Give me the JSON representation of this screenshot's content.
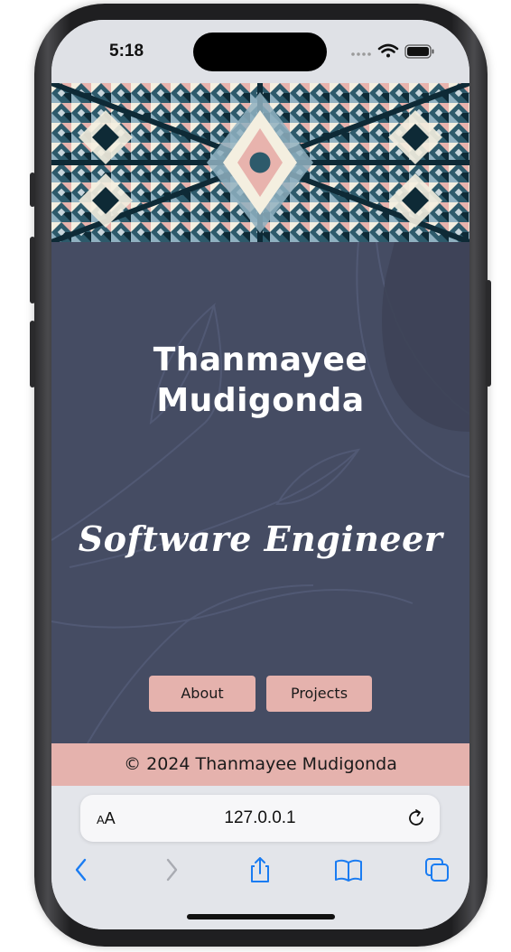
{
  "status_bar": {
    "time": "5:18",
    "icons": [
      "signal-dots-icon",
      "wifi-icon",
      "battery-icon"
    ]
  },
  "hero": {
    "image": "geometric-mosaic-banner",
    "colors": [
      "#2d5a6b",
      "#e8b3ad",
      "#f4efe0",
      "#0e2a36",
      "#8fb0c0"
    ]
  },
  "main": {
    "name": "Thanmayee Mudigonda",
    "subtitle": "Software Engineer",
    "background": "#454c63",
    "buttons": {
      "about_label": "About",
      "projects_label": "Projects"
    }
  },
  "footer": {
    "text": "© 2024 Thanmayee Mudigonda",
    "background": "#e5b2ad"
  },
  "browser": {
    "text_size_label": "AA",
    "url": "127.0.0.1",
    "toolbar": [
      "back-icon",
      "forward-icon",
      "share-icon",
      "bookmarks-icon",
      "tabs-icon"
    ],
    "accent": "#1a7cf2"
  }
}
